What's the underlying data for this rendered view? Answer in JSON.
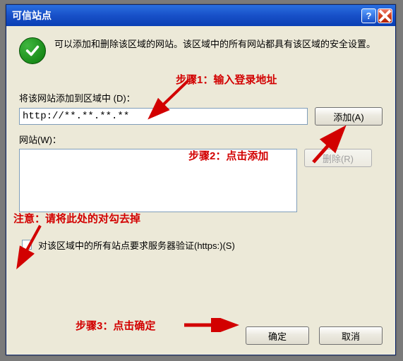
{
  "window": {
    "title": "可信站点"
  },
  "header": {
    "description": "可以添加和删除该区域的网站。该区域中的所有网站都具有该区域的安全设置。"
  },
  "add_section": {
    "label": "将该网站添加到区域中 (D)：",
    "url_value": "http://**.**.**.**",
    "add_button": "添加(A)"
  },
  "sites_section": {
    "label": "网站(W)：",
    "remove_button": "删除(R)"
  },
  "verify_checkbox": {
    "label": "对该区域中的所有站点要求服务器验证(https:)(S)"
  },
  "footer": {
    "ok": "确定",
    "cancel": "取消"
  },
  "annotations": {
    "step1": "步骤1：输入登录地址",
    "step2": "步骤2：点击添加",
    "note": "注意：请将此处的对勾去掉",
    "step3": "步骤3：点击确定"
  },
  "colors": {
    "annotation": "#d20000",
    "titlebar": "#1850c8",
    "panel": "#ece9d8"
  }
}
